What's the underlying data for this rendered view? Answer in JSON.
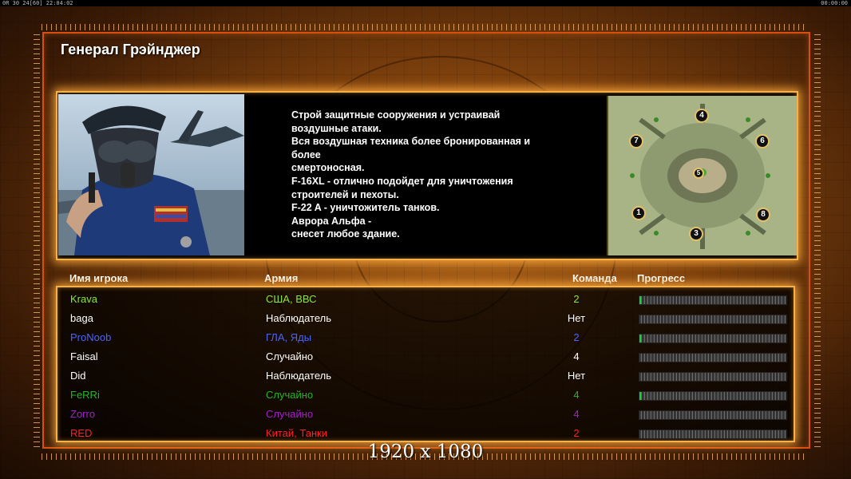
{
  "top_bar": {
    "left": "0R 30 24[60] 22:04:02",
    "right": "00:00:00"
  },
  "general": {
    "title": "Генерал Грэйнджер",
    "description_lines": [
      "Строй защитные сооружения и устраивай",
      " воздушные атаки.",
      "Вся воздушная техника более бронированная и",
      " более",
      "смертоносная.",
      "F-16XL - отлично подойдет для уничтожения",
      " строителей и пехоты.",
      "F-22 A - уничтожитель танков.",
      "Аврора Альфа -",
      "снесет любое здание."
    ]
  },
  "minimap": {
    "start_positions": [
      "4",
      "7",
      "6",
      "5",
      "1",
      "8",
      "3"
    ]
  },
  "columns": {
    "name": "Имя игрока",
    "army": "Армия",
    "team": "Команда",
    "progress": "Прогресс"
  },
  "players": [
    {
      "name": "Krava",
      "army": "США, ВВС",
      "team": "2",
      "color": "#8fe33a",
      "progress": 0.01
    },
    {
      "name": "baga",
      "army": "Наблюдатель",
      "team": "Нет",
      "color": "#ffffff",
      "progress": 0
    },
    {
      "name": "ProNoob",
      "army": "ГЛА, Яды",
      "team": "2",
      "color": "#4a64ff",
      "progress": 0.01
    },
    {
      "name": "Faisal",
      "army": "Случайно",
      "team": "4",
      "color": "#ffffff",
      "progress": 0
    },
    {
      "name": "Did",
      "army": "Наблюдатель",
      "team": "Нет",
      "color": "#ffffff",
      "progress": 0
    },
    {
      "name": "FeRRi",
      "army": "Случайно",
      "team": "4",
      "color": "#28b428",
      "progress": 0.01
    },
    {
      "name": "Zorro",
      "army": "Случайно",
      "team": "4",
      "color": "#a020d0",
      "progress": 0
    },
    {
      "name": "RED",
      "army": "Китай, Танки",
      "team": "2",
      "color": "#ff2020",
      "progress": 0
    }
  ],
  "resolution": "1920 x 1080"
}
